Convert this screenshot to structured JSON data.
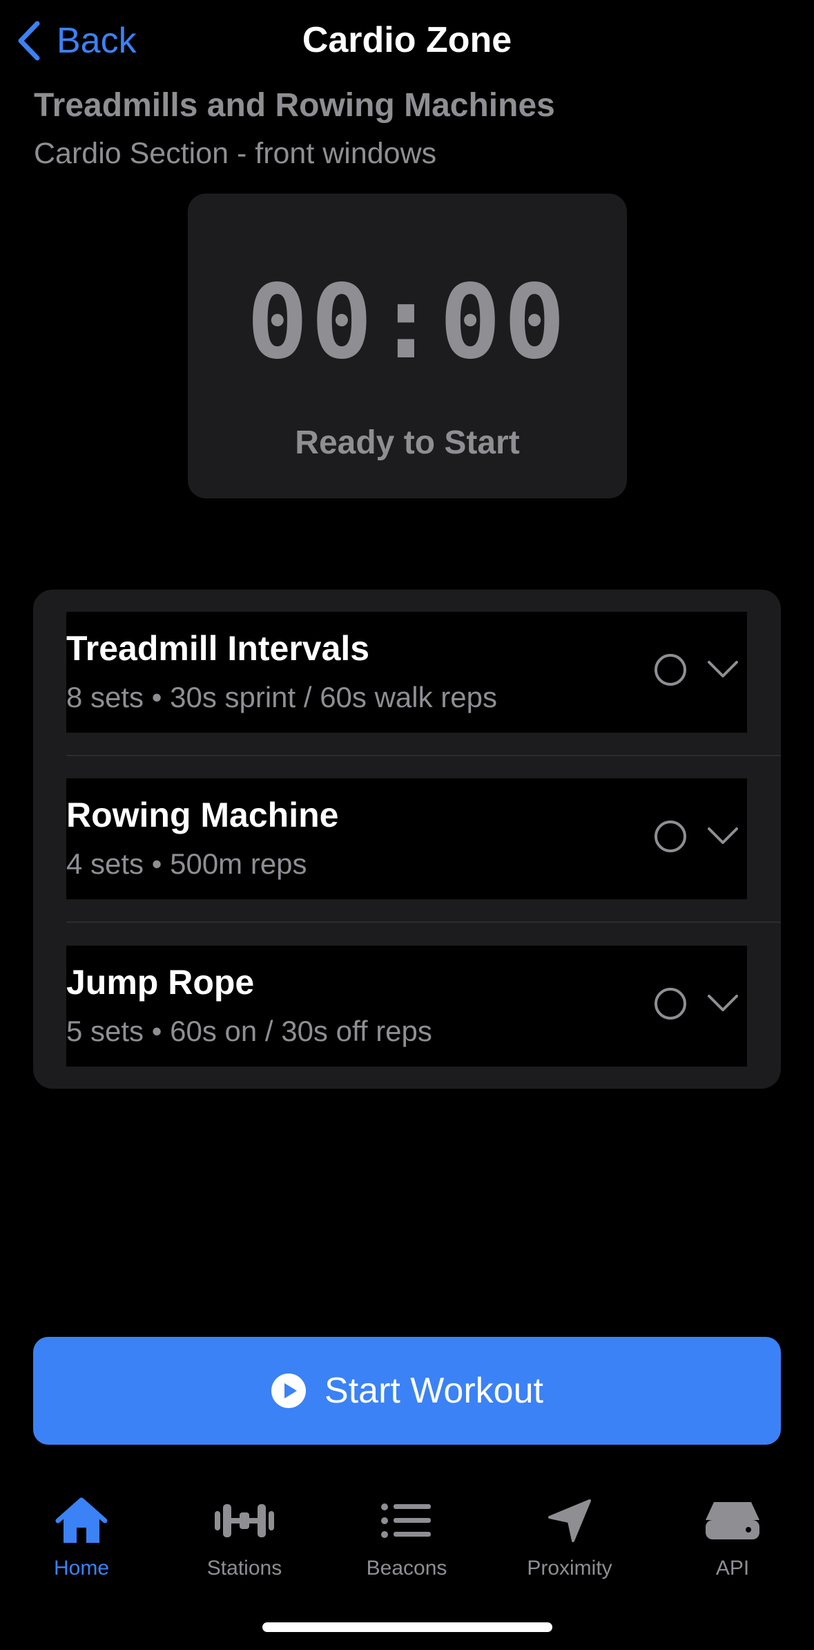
{
  "nav": {
    "back_label": "Back",
    "title": "Cardio Zone"
  },
  "station": {
    "name": "Treadmills and Rowing Machines",
    "location": "Cardio Section - front windows"
  },
  "timer": {
    "value": "00:00",
    "status": "Ready to Start"
  },
  "exercises": [
    {
      "title": "Treadmill Intervals",
      "detail": "8 sets • 30s sprint / 60s walk reps",
      "completed": false
    },
    {
      "title": "Rowing Machine",
      "detail": "4 sets • 500m reps",
      "completed": false
    },
    {
      "title": "Jump Rope",
      "detail": "5 sets • 60s on / 30s off reps",
      "completed": false
    }
  ],
  "start_button": {
    "label": "Start Workout",
    "icon": "play-circle-icon"
  },
  "tabbar": {
    "active": "Home",
    "tabs": [
      {
        "label": "Home",
        "icon": "house-icon"
      },
      {
        "label": "Stations",
        "icon": "dumbbell-icon"
      },
      {
        "label": "Beacons",
        "icon": "list-icon"
      },
      {
        "label": "Proximity",
        "icon": "location-arrow-icon"
      },
      {
        "label": "API",
        "icon": "server-icon"
      }
    ]
  },
  "colors": {
    "accent": "#3b82f6",
    "background": "#000000",
    "card": "#1c1c1e",
    "secondary_text": "#8e8e93"
  }
}
